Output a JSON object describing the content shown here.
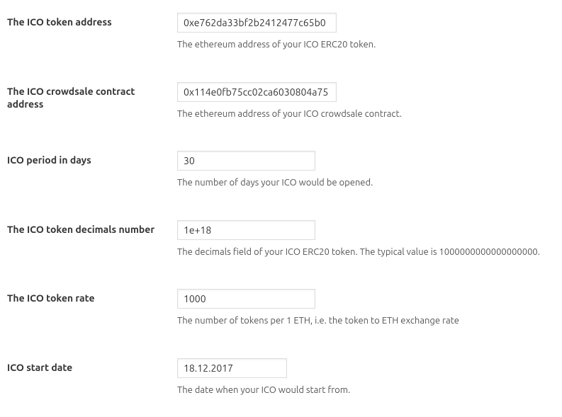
{
  "fields": {
    "token_address": {
      "label": "The ICO token address",
      "value": "0xe762da33bf2b2412477c65b0",
      "description": "The ethereum address of your ICO ERC20 token."
    },
    "crowdsale_address": {
      "label": "The ICO crowdsale contract address",
      "value": "0x114e0fb75cc02ca6030804a75",
      "description": "The ethereum address of your ICO crowdsale contract."
    },
    "period_days": {
      "label": "ICO period in days",
      "value": "30",
      "description": "The number of days your ICO would be opened."
    },
    "decimals": {
      "label": "The ICO token decimals number",
      "value": "1e+18",
      "description": "The decimals field of your ICO ERC20 token. The typical value is 1000000000000000000."
    },
    "rate": {
      "label": "The ICO token rate",
      "value": "1000",
      "description": "The number of tokens per 1 ETH, i.e. the token to ETH exchange rate"
    },
    "start_date": {
      "label": "ICO start date",
      "value": "18.12.2017",
      "description": "The date when your ICO would start from."
    }
  }
}
